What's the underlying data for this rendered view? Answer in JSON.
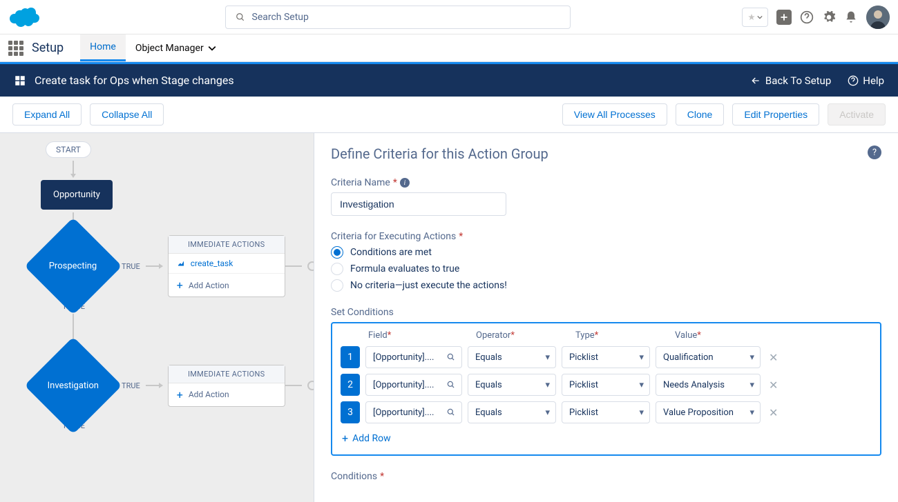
{
  "header": {
    "search_placeholder": "Search Setup"
  },
  "nav": {
    "app_name": "Setup",
    "tab_home": "Home",
    "tab_object_manager": "Object Manager"
  },
  "proc_bar": {
    "title": "Create task for Ops when Stage changes",
    "back_label": "Back To Setup",
    "help_label": "Help"
  },
  "toolbar": {
    "expand_all": "Expand All",
    "collapse_all": "Collapse All",
    "view_all": "View All Processes",
    "clone": "Clone",
    "edit_props": "Edit Properties",
    "activate": "Activate"
  },
  "flow": {
    "start": "START",
    "object": "Opportunity",
    "node1": "Prospecting",
    "node2": "Investigation",
    "true_label": "TRUE",
    "false_label": "FALSE",
    "imm_actions": "IMMEDIATE ACTIONS",
    "action_create_task": "create_task",
    "add_action": "Add Action"
  },
  "panel": {
    "title": "Define Criteria for this Action Group",
    "criteria_name_label": "Criteria Name",
    "criteria_name_value": "Investigation",
    "exec_label": "Criteria for Executing Actions",
    "radio_conditions": "Conditions are met",
    "radio_formula": "Formula evaluates to true",
    "radio_none": "No criteria—just execute the actions!",
    "set_conditions": "Set Conditions",
    "col_field": "Field",
    "col_operator": "Operator",
    "col_type": "Type",
    "col_value": "Value",
    "rows": [
      {
        "n": "1",
        "field": "[Opportunity]....",
        "op": "Equals",
        "type": "Picklist",
        "value": "Qualification"
      },
      {
        "n": "2",
        "field": "[Opportunity]....",
        "op": "Equals",
        "type": "Picklist",
        "value": "Needs Analysis"
      },
      {
        "n": "3",
        "field": "[Opportunity]....",
        "op": "Equals",
        "type": "Picklist",
        "value": "Value Proposition"
      }
    ],
    "add_row": "Add Row",
    "conditions_label": "Conditions"
  }
}
